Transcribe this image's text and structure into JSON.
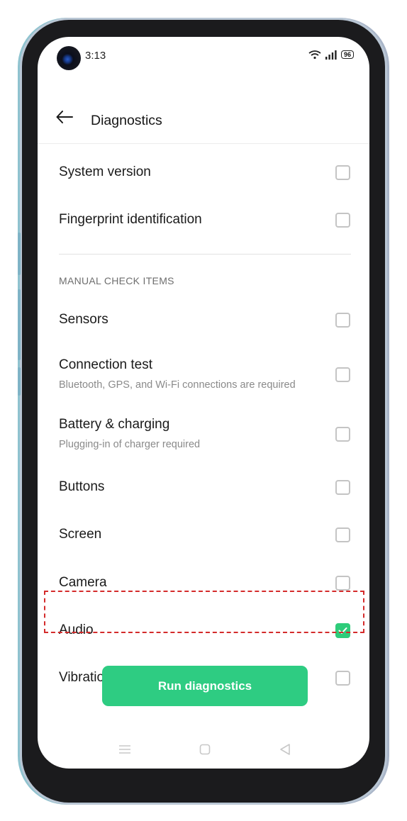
{
  "status_bar": {
    "time": "3:13",
    "battery": "96"
  },
  "header": {
    "title": "Diagnostics"
  },
  "top_items": [
    {
      "label": "System version",
      "checked": false
    },
    {
      "label": "Fingerprint identification",
      "checked": false
    }
  ],
  "section_title": "MANUAL CHECK ITEMS",
  "manual_items": [
    {
      "label": "Sensors",
      "subtitle": "",
      "checked": false
    },
    {
      "label": "Connection test",
      "subtitle": "Bluetooth, GPS, and Wi-Fi connections are required",
      "checked": false
    },
    {
      "label": "Battery & charging",
      "subtitle": "Plugging-in of charger required",
      "checked": false
    },
    {
      "label": "Buttons",
      "subtitle": "",
      "checked": false
    },
    {
      "label": "Screen",
      "subtitle": "",
      "checked": false
    },
    {
      "label": "Camera",
      "subtitle": "",
      "checked": false
    },
    {
      "label": "Audio",
      "subtitle": "",
      "checked": true
    },
    {
      "label": "Vibration",
      "subtitle": "",
      "checked": false
    }
  ],
  "run_button": {
    "label": "Run diagnostics"
  },
  "colors": {
    "accent": "#2ecc82",
    "highlight_border": "#d42b2b"
  }
}
